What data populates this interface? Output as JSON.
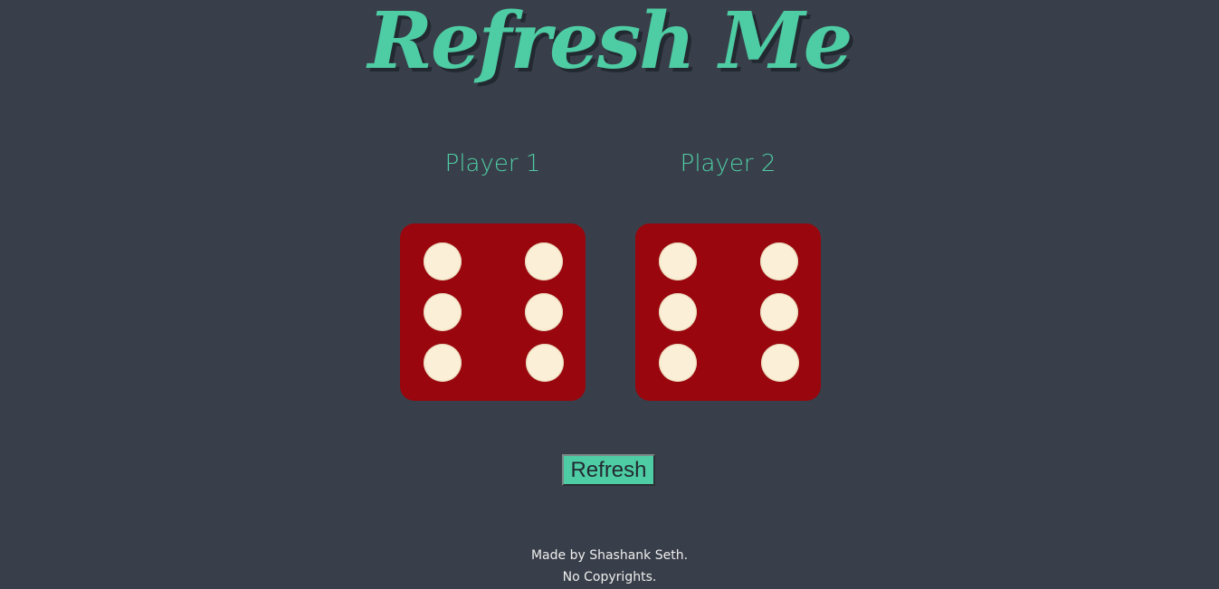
{
  "header": {
    "title": "Refresh Me"
  },
  "players": [
    {
      "label": "Player 1",
      "die_value": 6
    },
    {
      "label": "Player 2",
      "die_value": 6
    }
  ],
  "controls": {
    "refresh_label": "Refresh"
  },
  "footer": {
    "credit": "Made by Shashank Seth.",
    "copyright": "No Copyrights."
  },
  "colors": {
    "background": "#393f4a",
    "accent": "#4ecca3",
    "die": "#99060d",
    "pip": "#fbf0d7"
  }
}
